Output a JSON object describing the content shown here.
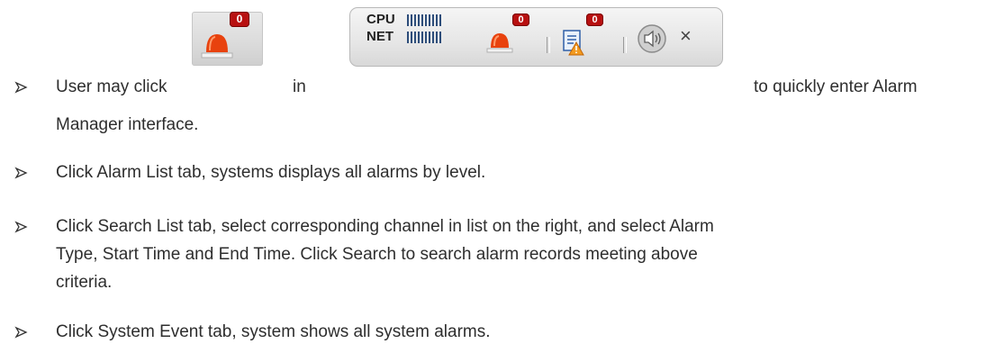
{
  "alarm_button": {
    "badge": "0",
    "icon": "siren-icon"
  },
  "toolbar": {
    "cpu_label": "CPU",
    "net_label": "NET",
    "cpu_meter_bars": 10,
    "net_meter_bars": 10,
    "alarm_badge": "0",
    "event_badge": "0",
    "alarm_icon": "siren-icon",
    "event_icon": "event-log-warning-icon",
    "sound_icon": "speaker-icon",
    "close_icon": "close-icon",
    "close_glyph": "×"
  },
  "text": {
    "line1_a": "User may click",
    "line1_b": "in",
    "line1_c": "to quickly enter Alarm",
    "line1_d": "Manager interface.",
    "bullet2": "Click Alarm List tab, systems displays all alarms by level.",
    "bullet3_l1": "Click Search List tab, select corresponding channel in list on the right, and select Alarm",
    "bullet3_l2": "Type, Start Time and End Time. Click Search to search alarm records meeting above",
    "bullet3_l3": "criteria.",
    "bullet4": "Click System Event tab, system shows all system alarms."
  }
}
